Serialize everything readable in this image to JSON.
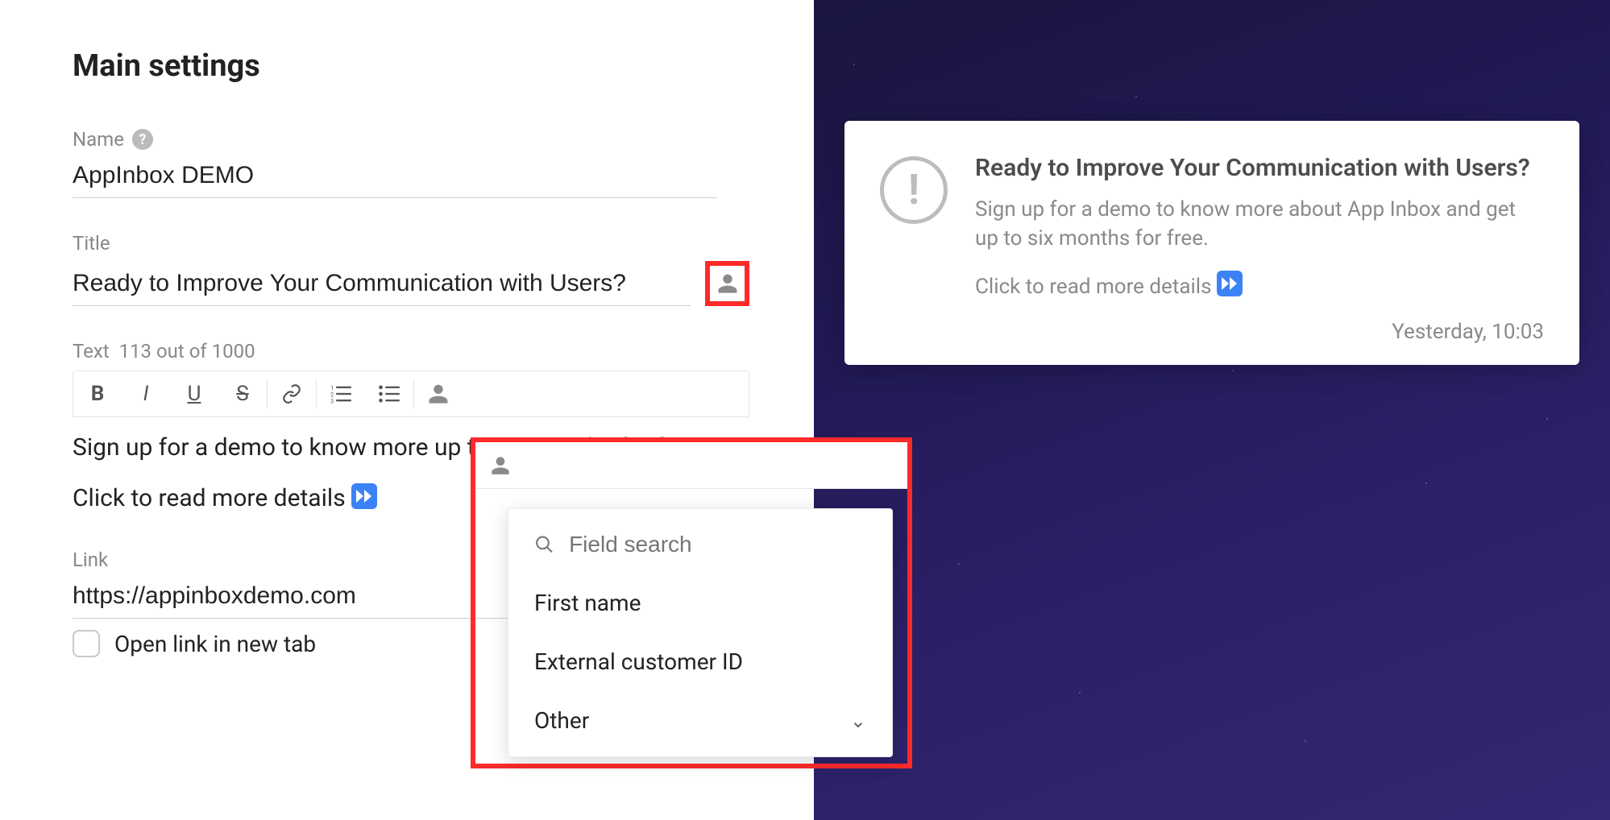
{
  "section_title": "Main settings",
  "name": {
    "label": "Name",
    "value": "AppInbox DEMO"
  },
  "title": {
    "label": "Title",
    "value": "Ready to Improve Your Communication with Users?"
  },
  "text": {
    "label": "Text",
    "counter": "113 out of 1000",
    "body_line1": "Sign up for a demo to know more up to six months for free.",
    "body_line2": "Click to read more details"
  },
  "link": {
    "label": "Link",
    "value": "https://appinboxdemo.com"
  },
  "open_new_tab_label": "Open link in new tab",
  "toolbar": {
    "bold": "B",
    "italic": "I",
    "underline": "U",
    "strike": "S"
  },
  "dropdown": {
    "search_placeholder": "Field search",
    "items": [
      "First name",
      "External customer ID",
      "Other"
    ]
  },
  "preview": {
    "title": "Ready to Improve Your Communication with Users?",
    "body": "Sign up for a demo to know more about App Inbox and get up to six months for free.",
    "cta": "Click to read more details",
    "time": "Yesterday, 10:03"
  }
}
